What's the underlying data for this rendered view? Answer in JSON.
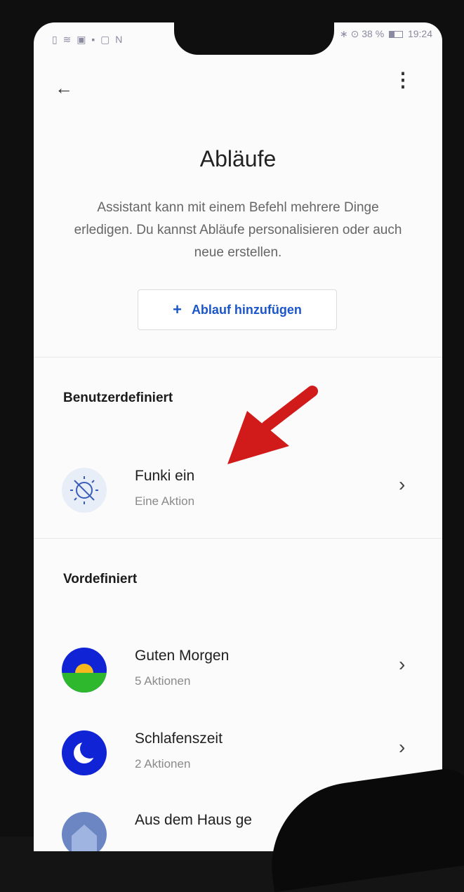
{
  "status_bar": {
    "left_icons": "▯ ≋ ▣ ▪ ▢ N",
    "battery": "38 %",
    "time": "19:24"
  },
  "header": {
    "back_icon": "←",
    "menu_icon": "⋮",
    "title": "Abläufe",
    "description": "Assistant kann mit einem Befehl mehrere Dinge erledigen. Du kannst Abläufe personalisieren oder auch neue erstellen."
  },
  "add_button": {
    "icon": "+",
    "label": "Ablauf hinzufügen"
  },
  "custom": {
    "heading": "Benutzerdefiniert",
    "items": [
      {
        "name": "Funki ein",
        "sub": "Eine Aktion",
        "icon": "no-signal-icon"
      }
    ]
  },
  "predefined": {
    "heading": "Vordefiniert",
    "items": [
      {
        "name": "Guten Morgen",
        "sub": "5 Aktionen",
        "icon": "sunrise-icon"
      },
      {
        "name": "Schlafenszeit",
        "sub": "2 Aktionen",
        "icon": "moon-icon"
      },
      {
        "name": "Aus dem Haus ge",
        "sub": "",
        "icon": "house-icon"
      }
    ]
  },
  "colors": {
    "accent": "#1a56c9",
    "arrow": "#d11a1a",
    "sun": "#f6b81d",
    "grass": "#2eb82e",
    "sky": "#1024d6"
  }
}
